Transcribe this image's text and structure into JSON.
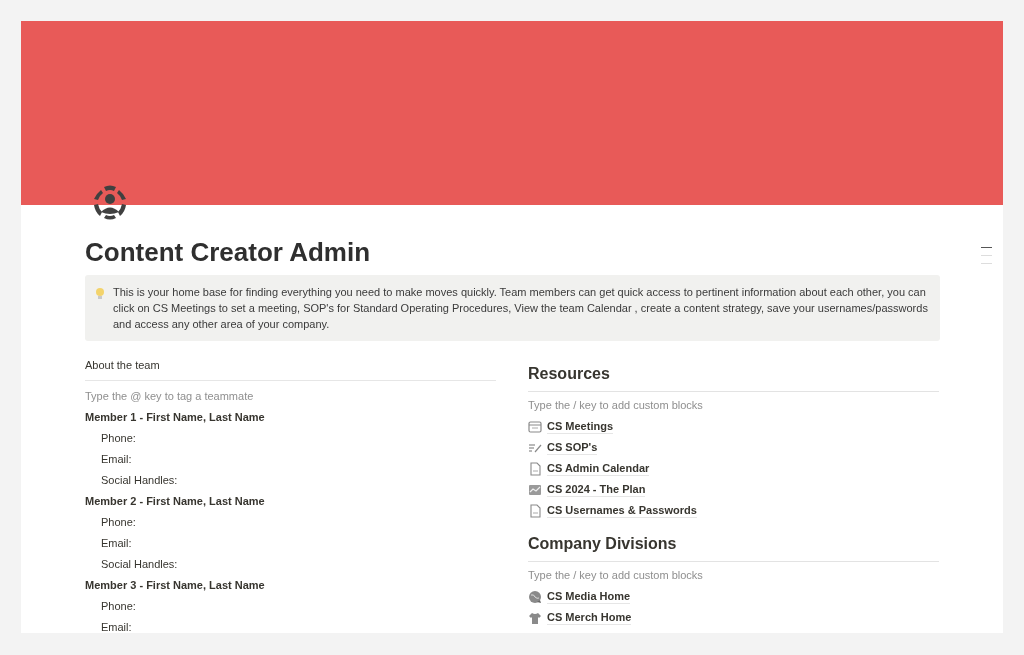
{
  "page": {
    "title": "Content Creator Admin",
    "callout": "This is your home base for finding everything you need to make moves quickly. Team members can get quick access to pertinent information about each other, you can click on CS Meetings to set a meeting, SOP's for Standard Operating Procedures, View the team Calendar , create a content strategy, save your usernames/passwords and access any other area of your company."
  },
  "team": {
    "heading": "About the team",
    "placeholder": "Type the @ key to tag a teammate",
    "members": [
      {
        "name": "Member 1 - First Name, Last Name",
        "fields": [
          "Phone:",
          "Email:",
          "Social Handles:"
        ]
      },
      {
        "name": "Member 2 - First Name, Last Name",
        "fields": [
          "Phone:",
          "Email:",
          "Social Handles:"
        ]
      },
      {
        "name": "Member 3 - First Name, Last Name",
        "fields": [
          "Phone:",
          "Email:"
        ]
      }
    ]
  },
  "sections": [
    {
      "heading": "Resources",
      "placeholder": "Type the / key to add custom blocks",
      "items": [
        {
          "label": "CS Meetings",
          "kind": "board"
        },
        {
          "label": "CS SOP's",
          "kind": "list"
        },
        {
          "label": "CS Admin Calendar",
          "kind": "doc"
        },
        {
          "label": "CS 2024 - The Plan",
          "kind": "chart"
        },
        {
          "label": "CS Usernames & Passwords",
          "kind": "doc"
        }
      ]
    },
    {
      "heading": "Company Divisions",
      "placeholder": "Type the / key to add custom blocks",
      "items": [
        {
          "label": "CS Media Home",
          "kind": "globe"
        },
        {
          "label": "CS Merch Home",
          "kind": "shirt"
        }
      ]
    }
  ]
}
